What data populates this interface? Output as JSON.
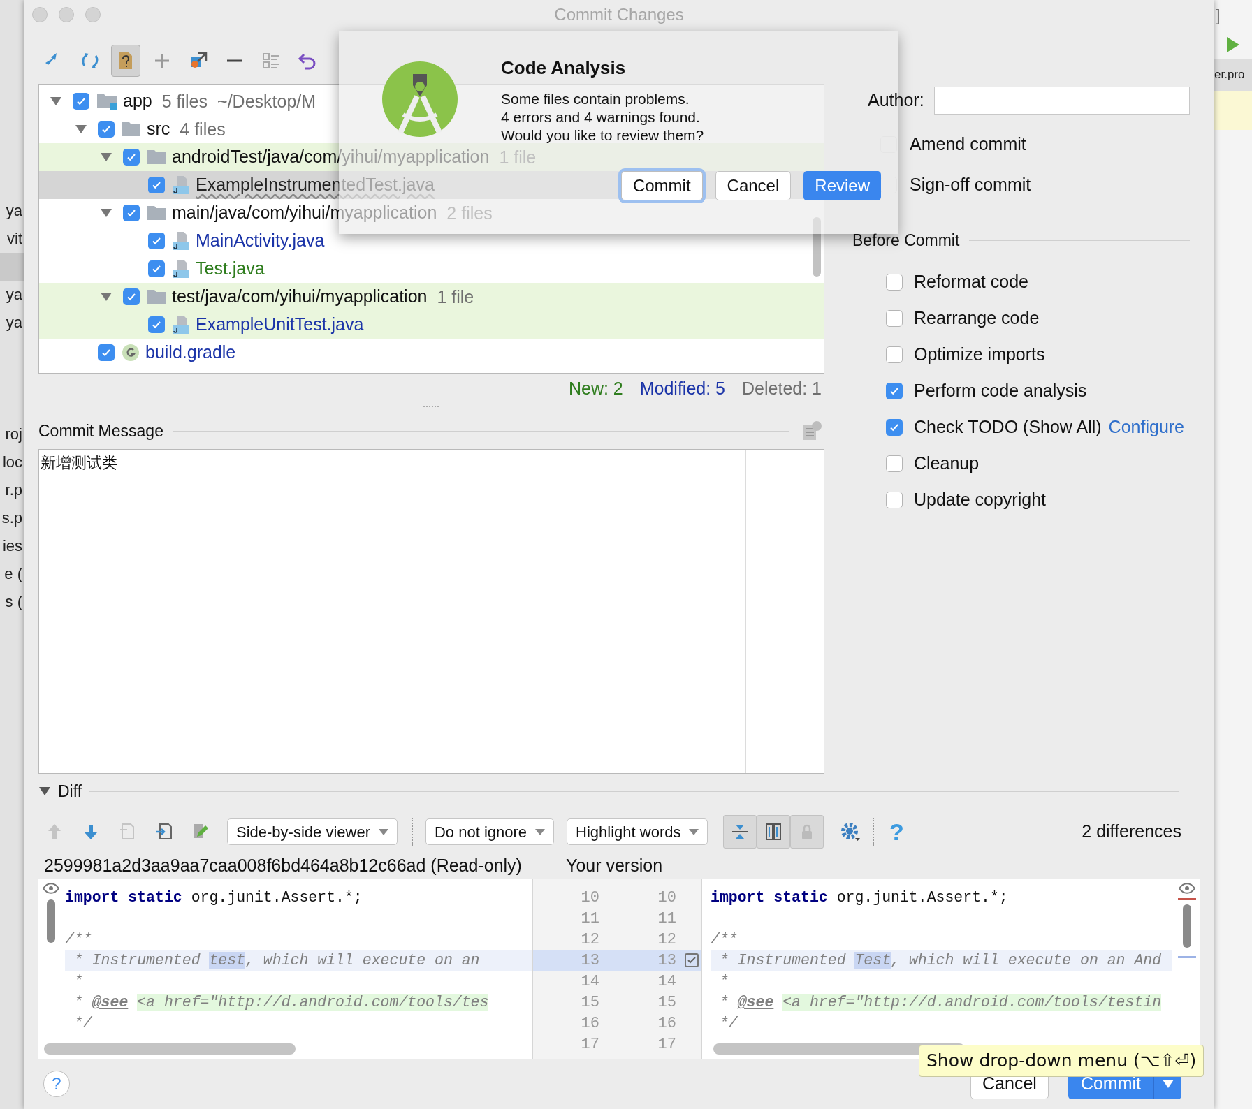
{
  "background_left": {
    "upper": [
      "ya",
      "vit"
    ],
    "middle": [
      "ya",
      "ya"
    ],
    "lower": [
      "roj",
      "loc",
      "r.p",
      "s.p",
      "ies",
      "e (",
      "s ("
    ]
  },
  "background_right": {
    "bracket": "]",
    "tab": "er.pro"
  },
  "window": {
    "title": "Commit Changes"
  },
  "toolbar": {
    "buttons": [
      {
        "selected": false
      },
      {
        "selected": false
      },
      {
        "selected": true
      },
      {
        "selected": false
      },
      {
        "selected": false
      },
      {
        "selected": false
      },
      {
        "selected": false
      },
      {
        "selected": false
      }
    ]
  },
  "tree": [
    {
      "label": "app",
      "extra": "5 files",
      "path": "~/Desktop/M",
      "kind": "module",
      "checked": true,
      "expanded": true,
      "highlighted": false,
      "selected": false,
      "children": [
        {
          "label": "src",
          "extra": "4 files",
          "kind": "folder",
          "checked": true,
          "expanded": true,
          "highlighted": false,
          "selected": false,
          "children": [
            {
              "label": "androidTest/java/com/yihui/myapplication",
              "extra": "1 file",
              "kind": "folder",
              "checked": true,
              "expanded": true,
              "highlighted": true,
              "selected": false,
              "children": [
                {
                  "label": "ExampleInstrumentedTest.java",
                  "kind": "file",
                  "checked": true,
                  "highlighted": false,
                  "selected": true,
                  "problem": true,
                  "color": "#222222"
                }
              ]
            },
            {
              "label": "main/java/com/yihui/myapplication",
              "extra": "2 files",
              "kind": "folder",
              "checked": true,
              "expanded": true,
              "highlighted": false,
              "selected": false,
              "children": [
                {
                  "label": "MainActivity.java",
                  "kind": "file",
                  "checked": true,
                  "highlighted": false,
                  "selected": false,
                  "problem": false,
                  "color": "#1b34a8"
                },
                {
                  "label": "Test.java",
                  "kind": "file",
                  "checked": true,
                  "highlighted": false,
                  "selected": false,
                  "problem": false,
                  "color": "#2f7d1e"
                }
              ]
            },
            {
              "label": "test/java/com/yihui/myapplication",
              "extra": "1 file",
              "kind": "folder",
              "checked": true,
              "expanded": true,
              "highlighted": true,
              "selected": false,
              "children": [
                {
                  "label": "ExampleUnitTest.java",
                  "kind": "file",
                  "checked": true,
                  "highlighted": true,
                  "selected": false,
                  "problem": false,
                  "color": "#1b34a8"
                }
              ]
            }
          ]
        },
        {
          "label": "build.gradle",
          "kind": "gradle",
          "checked": true,
          "highlighted": false,
          "selected": false,
          "problem": false,
          "color": "#1b34a8"
        }
      ]
    }
  ],
  "stats": [
    {
      "text": "New: 2",
      "color": "#2f7d1e"
    },
    {
      "text": "Modified: 5",
      "color": "#1b34a8"
    },
    {
      "text": "Deleted: 1",
      "color": "#6e6e6e"
    }
  ],
  "commit_message": {
    "label": "Commit Message",
    "value": "新增测试类"
  },
  "author": {
    "label": "Author:"
  },
  "git_options": [
    {
      "label": "Amend commit",
      "checked": false
    },
    {
      "label": "Sign-off commit",
      "checked": false
    }
  ],
  "before_commit": {
    "title": "Before Commit",
    "options": [
      {
        "label": "Reformat code",
        "checked": false
      },
      {
        "label": "Rearrange code",
        "checked": false
      },
      {
        "label": "Optimize imports",
        "checked": false
      },
      {
        "label": "Perform code analysis",
        "checked": true
      },
      {
        "label": "Check TODO (Show All)",
        "checked": true,
        "link": "Configure"
      },
      {
        "label": "Cleanup",
        "checked": false
      },
      {
        "label": "Update copyright",
        "checked": false
      }
    ]
  },
  "diff": {
    "title": "Diff",
    "expanded": true,
    "viewer": "Side-by-side viewer",
    "ignore": "Do not ignore",
    "highlight": "Highlight words",
    "help": "?",
    "count": "2 differences",
    "left_title": "2599981a2d3aa9aa7caa008f6bd464a8b12c66ad (Read-only)",
    "right_title": "Your version",
    "rows": [
      {
        "left_no": "10",
        "right_no": "10",
        "changed": false,
        "checked": false,
        "left": [
          {
            "text": "import static",
            "kind": "keyword"
          },
          {
            "text": " org.junit.Assert.*;",
            "kind": "plain"
          }
        ],
        "right": [
          {
            "text": "import static",
            "kind": "keyword"
          },
          {
            "text": " org.junit.Assert.*;",
            "kind": "plain"
          }
        ]
      },
      {
        "left_no": "11",
        "right_no": "11",
        "changed": false,
        "checked": false
      },
      {
        "left_no": "12",
        "right_no": "12",
        "changed": false,
        "checked": false,
        "left": [
          {
            "text": "/**",
            "kind": "comment"
          }
        ],
        "right": [
          {
            "text": "/**",
            "kind": "comment"
          }
        ]
      },
      {
        "left_no": "13",
        "right_no": "13",
        "changed": true,
        "checked": true,
        "left": [
          {
            "text": " * Instrumented ",
            "kind": "comment"
          },
          {
            "text": "test",
            "kind": "word"
          },
          {
            "text": ", which will execute on an",
            "kind": "comment"
          }
        ],
        "right": [
          {
            "text": " * Instrumented ",
            "kind": "comment"
          },
          {
            "text": "Test",
            "kind": "word"
          },
          {
            "text": ", which will execute on an And",
            "kind": "comment"
          }
        ]
      },
      {
        "left_no": "14",
        "right_no": "14",
        "changed": false,
        "checked": false,
        "left": [
          {
            "text": " *",
            "kind": "comment"
          }
        ],
        "right": [
          {
            "text": " *",
            "kind": "comment"
          }
        ]
      },
      {
        "left_no": "15",
        "right_no": "15",
        "changed": false,
        "checked": false,
        "left": [
          {
            "text": " * ",
            "kind": "comment"
          },
          {
            "text": "@see",
            "kind": "doctag"
          },
          {
            "text": "<a href=\"http://d.android.com/tools/tes",
            "kind": "link"
          }
        ],
        "right": [
          {
            "text": " * ",
            "kind": "comment"
          },
          {
            "text": "@see",
            "kind": "doctag"
          },
          {
            "text": "<a href=\"http://d.android.com/tools/testin",
            "kind": "link"
          }
        ]
      },
      {
        "left_no": "16",
        "right_no": "16",
        "changed": false,
        "checked": false,
        "left": [
          {
            "text": " */",
            "kind": "comment"
          }
        ],
        "right": [
          {
            "text": " */",
            "kind": "comment"
          }
        ]
      },
      {
        "left_no": "17",
        "right_no": "17",
        "changed": false,
        "checked": false
      }
    ]
  },
  "dialog": {
    "title": "Code Analysis",
    "lines": [
      "Some files contain problems.",
      "4 errors and 4 warnings found.",
      "Would you like to review them?"
    ],
    "buttons": [
      {
        "label": "Commit",
        "kind": "focused"
      },
      {
        "label": "Cancel",
        "kind": "plain"
      },
      {
        "label": "Review",
        "kind": "default"
      }
    ]
  },
  "tooltip": "Show drop-down menu (⌥⇧⏎)",
  "footer": {
    "help": "?",
    "cancel": "Cancel",
    "commit": "Commit"
  }
}
